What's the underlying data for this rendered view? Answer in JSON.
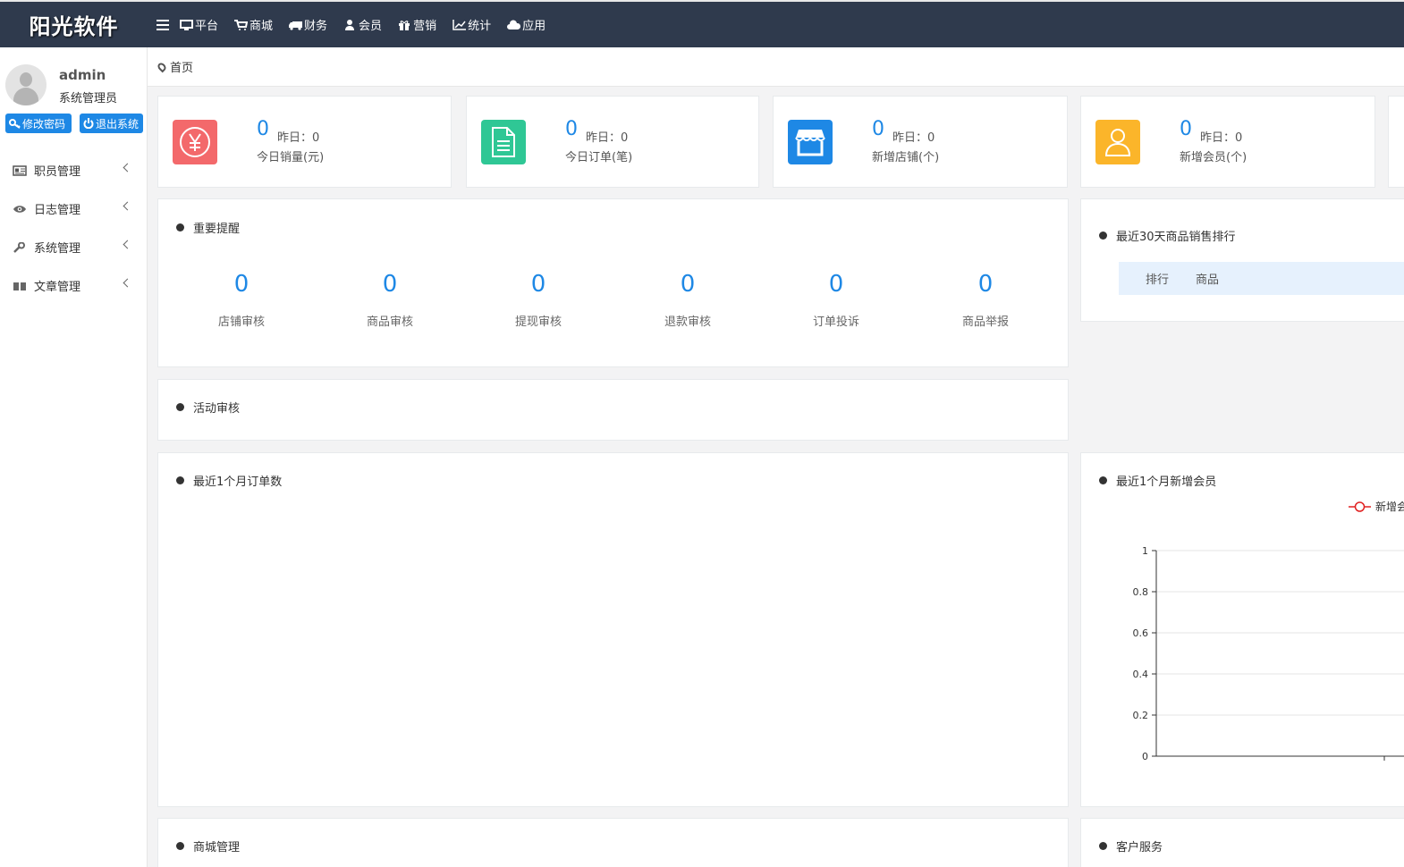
{
  "app": {
    "brand": "阳光软件"
  },
  "topnav": [
    {
      "label": "平台",
      "icon": "monitor-icon"
    },
    {
      "label": "商城",
      "icon": "cart-icon"
    },
    {
      "label": "财务",
      "icon": "truck-icon"
    },
    {
      "label": "会员",
      "icon": "user-icon"
    },
    {
      "label": "营销",
      "icon": "gift-icon"
    },
    {
      "label": "统计",
      "icon": "line-chart-icon"
    },
    {
      "label": "应用",
      "icon": "cloud-icon"
    }
  ],
  "user": {
    "name": "admin",
    "role": "系统管理员",
    "change_password": "修改密码",
    "logout": "退出系统"
  },
  "sidebar": {
    "items": [
      {
        "label": "职员管理",
        "icon": "id-card-icon"
      },
      {
        "label": "日志管理",
        "icon": "eye-icon"
      },
      {
        "label": "系统管理",
        "icon": "wrench-icon"
      },
      {
        "label": "文章管理",
        "icon": "book-icon"
      }
    ]
  },
  "breadcrumb": {
    "home": "首页"
  },
  "stats": [
    {
      "value": "0",
      "yesterday": "昨日：0",
      "label": "今日销量(元)",
      "color": "#f3696b",
      "icon": "yen-icon"
    },
    {
      "value": "0",
      "yesterday": "昨日：0",
      "label": "今日订单(笔)",
      "color": "#2fc795",
      "icon": "document-icon"
    },
    {
      "value": "0",
      "yesterday": "昨日：0",
      "label": "新增店铺(个)",
      "color": "#1e88e5",
      "icon": "store-icon"
    },
    {
      "value": "0",
      "yesterday": "昨日：0",
      "label": "新增会员(个)",
      "color": "#fbb52a",
      "icon": "member-icon"
    }
  ],
  "reminders": {
    "title": "重要提醒",
    "items": [
      {
        "value": "0",
        "label": "店铺审核"
      },
      {
        "value": "0",
        "label": "商品审核"
      },
      {
        "value": "0",
        "label": "提现审核"
      },
      {
        "value": "0",
        "label": "退款审核"
      },
      {
        "value": "0",
        "label": "订单投诉"
      },
      {
        "value": "0",
        "label": "商品举报"
      }
    ]
  },
  "activity": {
    "title": "活动审核"
  },
  "ranking": {
    "title": "最近30天商品销售排行",
    "columns": [
      "排行",
      "商品"
    ]
  },
  "orders_chart": {
    "title": "最近1个月订单数"
  },
  "members_chart": {
    "title": "最近1个月新增会员"
  },
  "mall": {
    "title": "商城管理"
  },
  "service": {
    "title": "客户服务"
  },
  "chart_data": {
    "type": "line",
    "title": "",
    "series": [
      {
        "name": "新增会员",
        "values": []
      }
    ],
    "legend": "top-right",
    "legend_visible_text": "新增会",
    "ylim": [
      0,
      1
    ],
    "yticks": [
      "0",
      "0.2",
      "0.4",
      "0.6",
      "0.8",
      "1"
    ],
    "grid": true,
    "series_color": "#e02020"
  }
}
